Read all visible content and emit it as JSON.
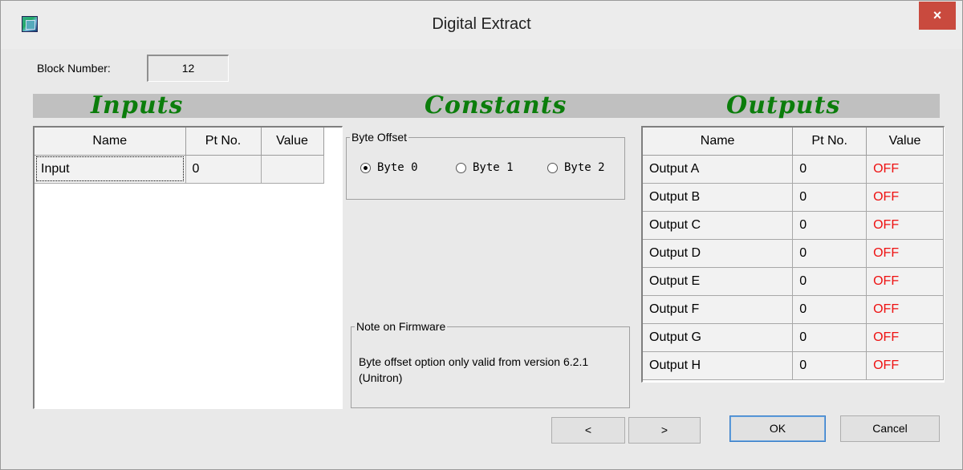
{
  "window": {
    "title": "Digital Extract",
    "close_label": "×"
  },
  "block": {
    "label": "Block Number:",
    "value": "12"
  },
  "sections": {
    "inputs": "Inputs",
    "constants": "Constants",
    "outputs": "Outputs"
  },
  "inputs": {
    "columns": [
      "Name",
      "Pt No.",
      "Value"
    ],
    "rows": [
      {
        "name": "Input",
        "pt": "0",
        "value": ""
      }
    ]
  },
  "constants": {
    "byte_offset_label": "Byte Offset",
    "options": [
      "Byte 0",
      "Byte 1",
      "Byte 2"
    ],
    "selected": "Byte 0",
    "note_label": "Note on Firmware",
    "note_text": "Byte offset option only valid from version 6.2.1 (Unitron)"
  },
  "outputs": {
    "columns": [
      "Name",
      "Pt No.",
      "Value"
    ],
    "rows": [
      {
        "name": "Output A",
        "pt": "0",
        "value": "OFF"
      },
      {
        "name": "Output B",
        "pt": "0",
        "value": "OFF"
      },
      {
        "name": "Output C",
        "pt": "0",
        "value": "OFF"
      },
      {
        "name": "Output D",
        "pt": "0",
        "value": "OFF"
      },
      {
        "name": "Output E",
        "pt": "0",
        "value": "OFF"
      },
      {
        "name": "Output F",
        "pt": "0",
        "value": "OFF"
      },
      {
        "name": "Output G",
        "pt": "0",
        "value": "OFF"
      },
      {
        "name": "Output H",
        "pt": "0",
        "value": "OFF"
      }
    ]
  },
  "buttons": {
    "prev": "<",
    "next": ">",
    "ok": "OK",
    "cancel": "Cancel"
  },
  "colors": {
    "header_green": "#0b7d0b",
    "off_red": "#ee1111",
    "close_red": "#c94a3e"
  },
  "icons": {
    "app": "app-icon",
    "close": "close-icon"
  }
}
